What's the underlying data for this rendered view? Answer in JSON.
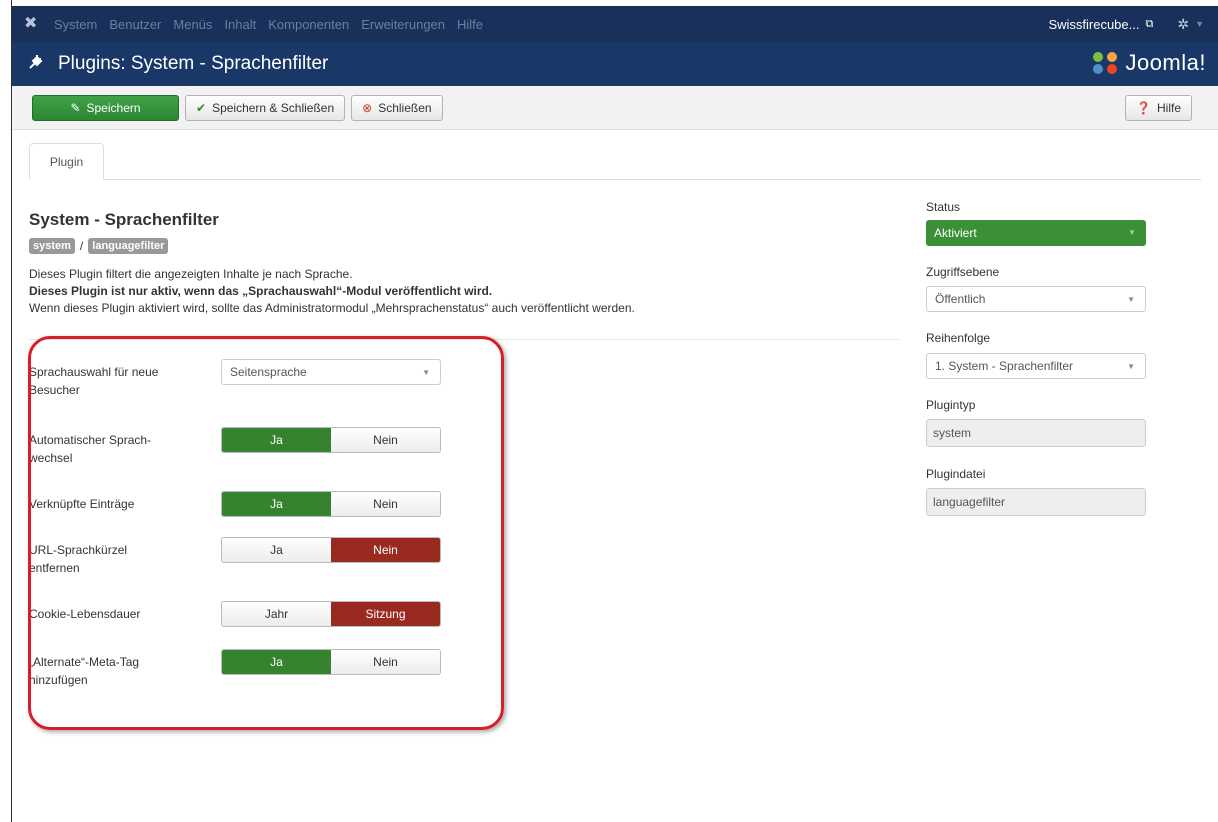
{
  "menubar": {
    "items": [
      "System",
      "Benutzer",
      "Menüs",
      "Inhalt",
      "Komponenten",
      "Erweiterungen",
      "Hilfe"
    ],
    "site_name": "Swissfirecube...",
    "icons": {
      "joomla": "joomla-icon",
      "external": "external-link-icon",
      "settings": "gear-icon"
    }
  },
  "header": {
    "title": "Plugins: System - Sprachenfilter",
    "logo_text": "Joomla!",
    "icon": "plug-icon"
  },
  "toolbar": {
    "save_label": "Speichern",
    "save_close_label": "Speichern & Schließen",
    "close_label": "Schließen",
    "help_label": "Hilfe"
  },
  "tabs": [
    {
      "label": "Plugin",
      "active": true
    }
  ],
  "main": {
    "title": "System - Sprachenfilter",
    "badge_folder": "system",
    "badge_separator": "/",
    "badge_element": "languagefilter",
    "description_line1": "Dieses Plugin filtert die angezeigten Inhalte je nach Sprache.",
    "description_line2": "Dieses Plugin ist nur aktiv, wenn das „Sprachauswahl“-Modul veröffentlicht wird.",
    "description_line3": "Wenn dieses Plugin aktiviert wird, sollte das Administratormodul „Mehrsprachenstatus“ auch veröffentlicht werden."
  },
  "fields": [
    {
      "label_line1": "Sprachauswahl für neue",
      "label_line2": "Besucher",
      "type": "select",
      "value": "Seitensprache"
    },
    {
      "label_line1": "Automatischer Sprach-",
      "label_line2": "wechsel",
      "type": "toggle",
      "options": [
        "Ja",
        "Nein"
      ],
      "selected": "Ja"
    },
    {
      "label_line1": "Verknüpfte Einträge",
      "label_line2": "",
      "type": "toggle",
      "options": [
        "Ja",
        "Nein"
      ],
      "selected": "Ja"
    },
    {
      "label_line1": "URL-Sprachkürzel",
      "label_line2": "entfernen",
      "type": "toggle",
      "options": [
        "Ja",
        "Nein"
      ],
      "selected": "Nein"
    },
    {
      "label_line1": "Cookie-Lebensdauer",
      "label_line2": "",
      "type": "toggle",
      "options": [
        "Jahr",
        "Sitzung"
      ],
      "selected": "Sitzung"
    },
    {
      "label_line1": "„Alternate“-Meta-Tag",
      "label_line2": "hinzufügen",
      "type": "toggle",
      "options": [
        "Ja",
        "Nein"
      ],
      "selected": "Ja"
    }
  ],
  "sidebar": {
    "status_label": "Status",
    "status_value": "Aktiviert",
    "access_label": "Zugriffsebene",
    "access_value": "Öffentlich",
    "ordering_label": "Reihenfolge",
    "ordering_value": "1. System - Sprachenfilter",
    "type_label": "Plugintyp",
    "type_value": "system",
    "file_label": "Plugindatei",
    "file_value": "languagefilter"
  },
  "colors": {
    "menubar": "#18305a",
    "header": "#1a3867",
    "active_green": "#35822f",
    "active_red": "#9a2a20",
    "annotation_red": "#d61f28"
  }
}
